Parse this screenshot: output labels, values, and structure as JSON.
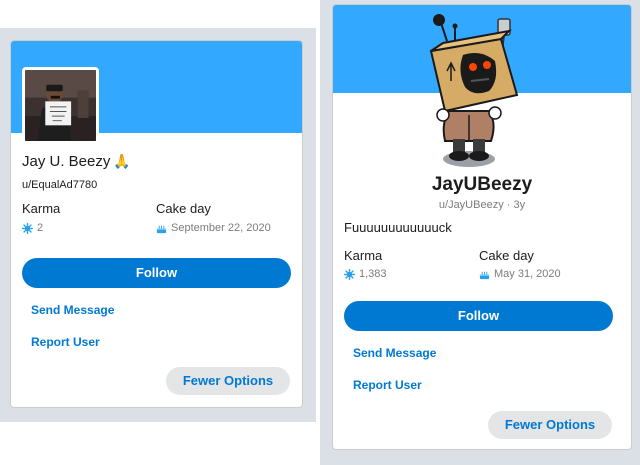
{
  "left_card": {
    "display_name": "Jay U. Beezy",
    "emoji": "🙏",
    "username": "u/EqualAd7780",
    "karma_label": "Karma",
    "karma_value": "2",
    "cake_label": "Cake day",
    "cake_value": "September 22, 2020",
    "follow_label": "Follow",
    "send_message_label": "Send Message",
    "report_user_label": "Report User",
    "fewer_options_label": "Fewer Options"
  },
  "right_card": {
    "display_name": "JayUBeezy",
    "username": "u/JayUBeezy · 3y",
    "bio": "Fuuuuuuuuuuuuck",
    "karma_label": "Karma",
    "karma_value": "1,383",
    "cake_label": "Cake day",
    "cake_value": "May 31, 2020",
    "follow_label": "Follow",
    "send_message_label": "Send Message",
    "report_user_label": "Report User",
    "fewer_options_label": "Fewer Options"
  },
  "colors": {
    "banner": "#33a8ff",
    "accent": "#0079d3",
    "page_bg": "#dae0e6",
    "secondary_btn": "#e4e5e6"
  },
  "icons": {
    "karma": "karma-icon",
    "cake": "cake-icon",
    "snoo_avatar": "snoo-box-head-avatar",
    "profile_photo": "profile-photo"
  }
}
